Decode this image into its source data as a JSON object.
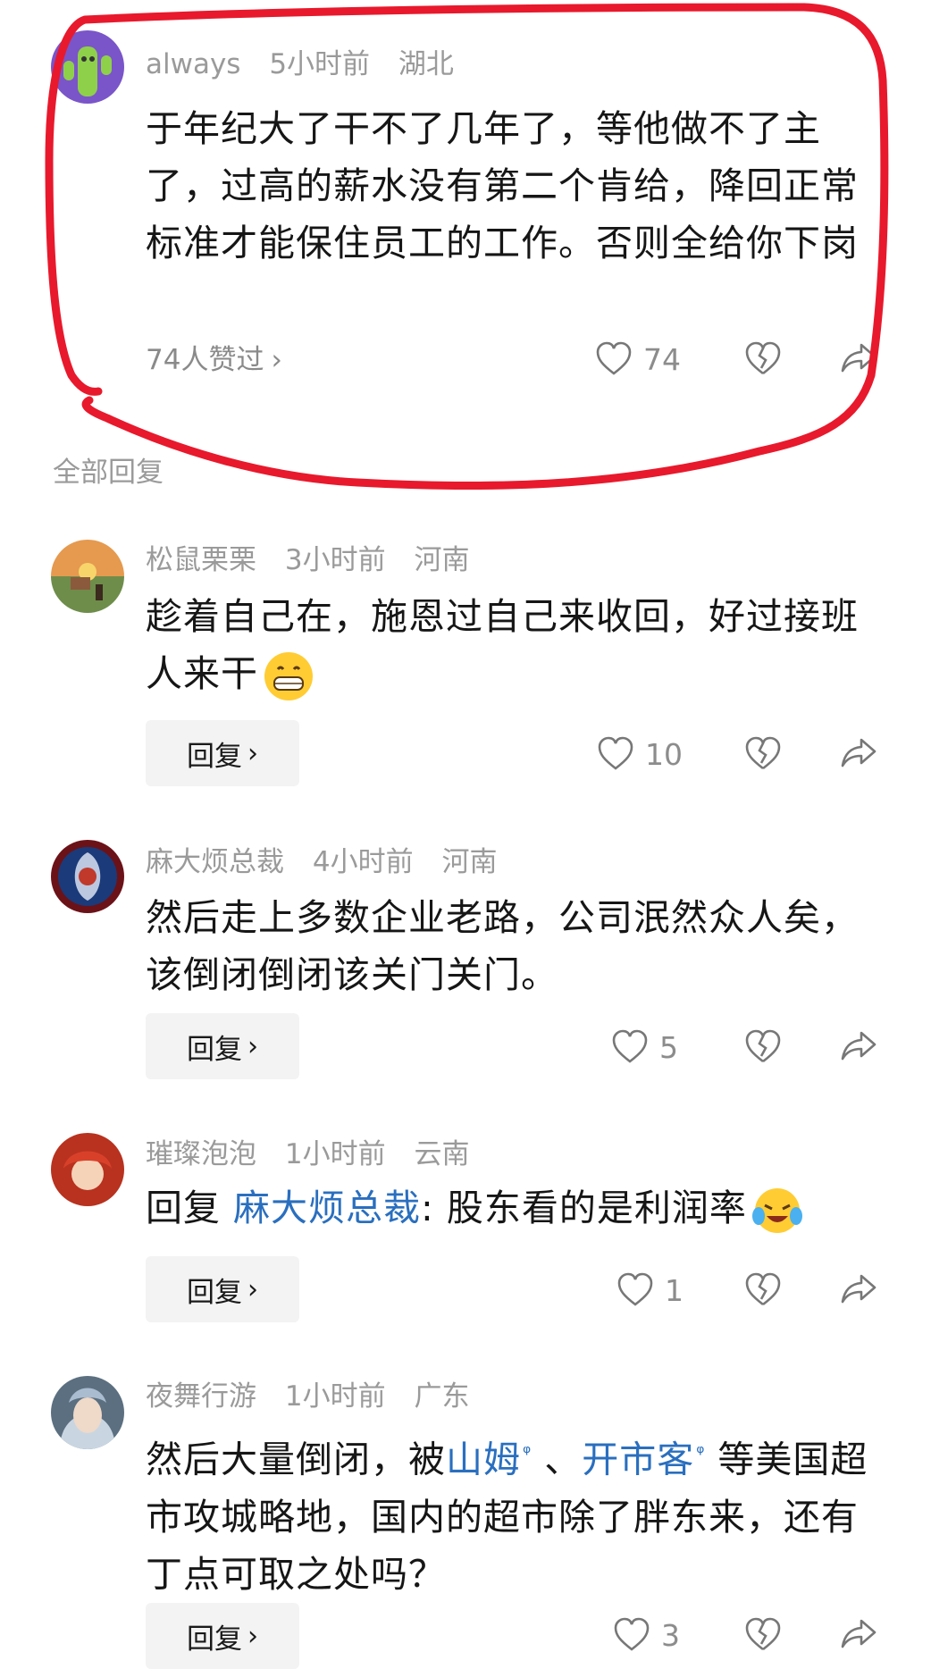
{
  "top_comment": {
    "username": "always",
    "time": "5小时前",
    "location": "湖北",
    "text": "于年纪大了干不了几年了，等他做不了主了，过高的薪水没有第二个肯给，降回正常标准才能保住员工的工作。否则全给你下岗",
    "liked_by": "74人赞过",
    "like_count": "74"
  },
  "section_title": "全部回复",
  "replies": [
    {
      "username": "松鼠栗栗",
      "time": "3小时前",
      "location": "河南",
      "text": "趁着自己在，施恩过自己来收回，好过接班人来干",
      "reply_label": "回复",
      "like_count": "10"
    },
    {
      "username": "麻大烦总裁",
      "time": "4小时前",
      "location": "河南",
      "text": "然后走上多数企业老路，公司泯然众人矣，该倒闭倒闭该关门关门。",
      "reply_label": "回复",
      "like_count": "5"
    },
    {
      "username": "璀璨泡泡",
      "time": "1小时前",
      "location": "云南",
      "text_prefix": "回复 ",
      "mention": "麻大烦总裁",
      "text_suffix": ": 股东看的是利润率",
      "reply_label": "回复",
      "like_count": "1"
    },
    {
      "username": "夜舞行游",
      "time": "1小时前",
      "location": "广东",
      "text_a": "然后大量倒闭，被",
      "link1": "山姆",
      "text_b": " 、",
      "link2": "开市客",
      "text_c": " 等美国超市攻城略地，国内的超市除了胖东来，还有丁点可取之处吗？",
      "reply_label": "回复",
      "like_count": "3"
    }
  ],
  "colors": {
    "highlight_stroke": "#e8192c",
    "meta_text": "#9a9a9a",
    "link": "#2a6fbf",
    "reply_button_bg": "#f3f3f3"
  },
  "icons": {
    "like": "heart-outline-icon",
    "dislike": "broken-heart-icon",
    "share": "share-arrow-icon",
    "search_hint": "search-icon"
  }
}
